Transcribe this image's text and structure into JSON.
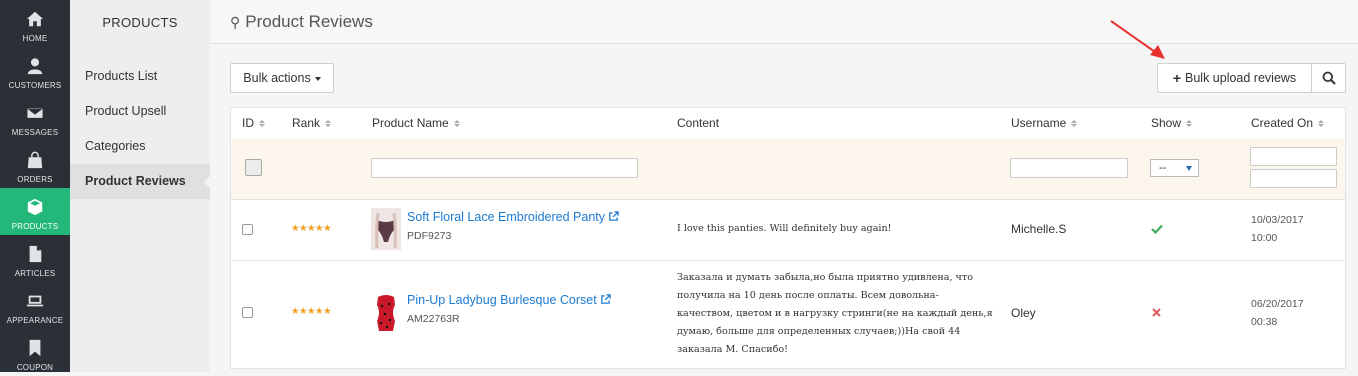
{
  "nav": {
    "items": [
      {
        "label": "HOME",
        "icon": "home-icon"
      },
      {
        "label": "CUSTOMERS",
        "icon": "user-icon"
      },
      {
        "label": "MESSAGES",
        "icon": "envelope-icon"
      },
      {
        "label": "ORDERS",
        "icon": "shopping-bag-icon"
      },
      {
        "label": "PRODUCTS",
        "icon": "box-icon"
      },
      {
        "label": "ARTICLES",
        "icon": "file-icon"
      },
      {
        "label": "APPEARANCE",
        "icon": "laptop-icon"
      },
      {
        "label": "COUPON",
        "icon": "bookmark-icon"
      }
    ],
    "active_color": "#24b77a"
  },
  "subnav": {
    "title": "PRODUCTS",
    "links": [
      {
        "label": "Products List"
      },
      {
        "label": "Product Upsell"
      },
      {
        "label": "Categories"
      },
      {
        "label": "Product Reviews"
      }
    ]
  },
  "header": {
    "title": "Product Reviews"
  },
  "toolbar": {
    "bulk_actions": "Bulk actions",
    "bulk_upload": "Bulk upload reviews"
  },
  "table": {
    "columns": [
      "ID",
      "Rank",
      "Product Name",
      "Content",
      "Username",
      "Show",
      "Created On"
    ],
    "show_filter": "--",
    "rows": [
      {
        "rank_stars": "★★★★★",
        "product_name": "Soft Floral Lace Embroidered Panty",
        "sku": "PDF9273",
        "content": "I love this panties. Will definitely buy again!",
        "username": "Michelle.S",
        "show": true,
        "created_date": "10/03/2017",
        "created_time": "10:00"
      },
      {
        "rank_stars": "★★★★★",
        "product_name": "Pin-Up Ladybug Burlesque Corset",
        "sku": "AM22763R",
        "content": "Заказала и думать забыла,но была приятно удивлена, что получила на 10 день после оплаты. Всем довольна- качеством, цветом и в нагрузку стринги(не на каждый день,я думаю, больше для определенных случаев;))На свой 44 заказала М. Спасибо!",
        "username": "Oley",
        "show": false,
        "created_date": "06/20/2017",
        "created_time": "00:38"
      }
    ]
  },
  "colors": {
    "link": "#1c7bd0",
    "star": "#f0a020",
    "check": "#3cae5c",
    "cross": "#e05a5a",
    "arrow": "#e8312f"
  }
}
